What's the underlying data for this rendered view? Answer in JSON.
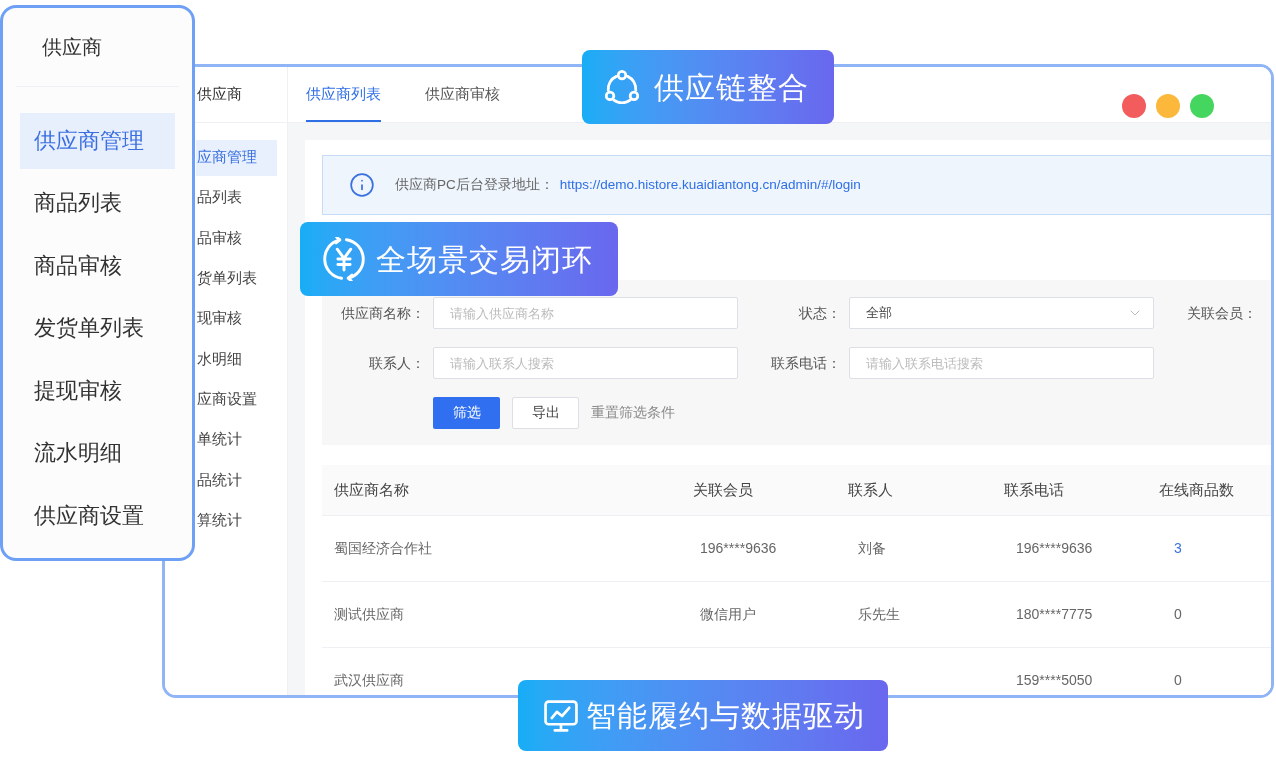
{
  "side_panel": {
    "title": "供应商",
    "items": [
      {
        "label": "供应商管理",
        "selected": true
      },
      {
        "label": "商品列表",
        "selected": false
      },
      {
        "label": "商品审核",
        "selected": false
      },
      {
        "label": "发货单列表",
        "selected": false
      },
      {
        "label": "提现审核",
        "selected": false
      },
      {
        "label": "流水明细",
        "selected": false
      },
      {
        "label": "供应商设置",
        "selected": false
      }
    ]
  },
  "window": {
    "sidebar": {
      "title": "供应商",
      "items": [
        {
          "label": "应商管理",
          "selected": true
        },
        {
          "label": "品列表",
          "selected": false
        },
        {
          "label": "品审核",
          "selected": false
        },
        {
          "label": "货单列表",
          "selected": false
        },
        {
          "label": "现审核",
          "selected": false
        },
        {
          "label": "水明细",
          "selected": false
        },
        {
          "label": "应商设置",
          "selected": false
        },
        {
          "label": "单统计",
          "selected": false
        },
        {
          "label": "品统计",
          "selected": false
        },
        {
          "label": "算统计",
          "selected": false
        }
      ]
    },
    "tabs": [
      {
        "label": "供应商列表",
        "selected": true
      },
      {
        "label": "供应商审核",
        "selected": false
      }
    ],
    "notice": {
      "label": "供应商PC后台登录地址：",
      "link": "https://demo.histore.kuaidiantong.cn/admin/#/login"
    },
    "filters": [
      {
        "label": "供应商名称：",
        "kind": "input",
        "placeholder": "请输入供应商名称"
      },
      {
        "label": "状态：",
        "kind": "select",
        "value": "全部"
      },
      {
        "label": "关联会员：",
        "kind": "label"
      },
      {
        "label": "联系人：",
        "kind": "input",
        "placeholder": "请输入联系人搜索"
      },
      {
        "label": "联系电话：",
        "kind": "input",
        "placeholder": "请输入联系电话搜索"
      }
    ],
    "actions": [
      {
        "label": "筛选",
        "kind": "primary"
      },
      {
        "label": "导出",
        "kind": "default"
      },
      {
        "label": "重置筛选条件",
        "kind": "link"
      }
    ],
    "table": {
      "columns": [
        "供应商名称",
        "关联会员",
        "联系人",
        "联系电话",
        "在线商品数"
      ],
      "rows": [
        {
          "name": "蜀国经济合作社",
          "member": "196****9636",
          "contact": "刘备",
          "phone": "196****9636",
          "online_products": "3",
          "online_products_link": true
        },
        {
          "name": "测试供应商",
          "member": "微信用户",
          "contact": "乐先生",
          "phone": "180****7775",
          "online_products": "0",
          "online_products_link": false
        },
        {
          "name": "武汉供应商",
          "phone": "159****5050",
          "online_products": "0",
          "online_products_link": false
        }
      ]
    }
  },
  "badges": [
    {
      "label": "供应链整合",
      "kind": "network"
    },
    {
      "label": "全场景交易闭环",
      "kind": "yuan"
    },
    {
      "label": "智能履约与数据驱动",
      "kind": "chart"
    }
  ]
}
